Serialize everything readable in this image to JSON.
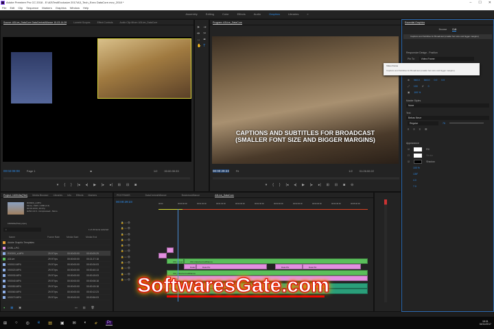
{
  "window": {
    "title": "Adobe Premiere Pro CC 2018 - E:\\A3\\Test\\Exclusive 2017\\A3_Tech_Exec DataCore.mov_2018 *",
    "min": "–",
    "max": "☐",
    "close": "✕"
  },
  "menu": [
    "File",
    "Edit",
    "Clip",
    "Sequence",
    "Markers",
    "Graphics",
    "Window",
    "Help"
  ],
  "workspaces": [
    "Assembly",
    "Editing",
    "Color",
    "Effects",
    "Audio",
    "Graphics",
    "Libraries",
    "»"
  ],
  "source": {
    "tabs": [
      "Source: A3Live_DataCore DataCentralAlliance 10-03-14.09",
      "Lumetri Scopes",
      "Effect Controls",
      "Audio Clip Mixer: A3Live_DataCore"
    ],
    "timecode": "00:02:08:08",
    "page": "Page 1",
    "zoom": "1/2",
    "duration": "00:00:39:33"
  },
  "program": {
    "tab": "Program: A3Live_DataCore",
    "caption_line1": "CAPTIONS AND SUBTITLES FOR BROADCAST",
    "caption_line2": "(SMALLER FONT SIZE AND BIGGER MARGINS)",
    "timecode": "00:00:29:23",
    "fit": "Fit",
    "zoom": "1/2",
    "duration": "01:26:00:22"
  },
  "essential_graphics": {
    "tab": "Essential Graphics",
    "browse": "Browse",
    "edit": "Edit",
    "layer": "Captions and Subtitles for Broadcast (smaller font size and bigger margins)",
    "responsive": "Responsive Design - Position",
    "pin_label": "Pin To:",
    "pin_value": "Video Frame",
    "popup": [
      "Video Frame",
      "Captions and Subtitles for Broadcast (smaller font size and bigger margins)"
    ],
    "pos_x": "960.0",
    "pos_y": "540.0",
    "anchor_x": "0.0",
    "anchor_y": "0.0",
    "scale": "100",
    "rotation": "0",
    "opacity": "100 %",
    "master_styles": "Master Styles",
    "master_value": "None",
    "text_label": "Text",
    "font": "Bebas Neue",
    "font_style": "Regular",
    "font_size": "76",
    "appearance": "Appearance",
    "fill": "Fill",
    "stroke": "Stroke",
    "shadow": "Shadow",
    "shadow_opacity": "100 %",
    "shadow_angle": "135°",
    "shadow_distance": "4.0",
    "shadow_size": "7.0"
  },
  "project": {
    "tabs": [
      "Project: 160918a(Titel)",
      "Media Browser",
      "Libraries",
      "Info",
      "Effects",
      "Markers"
    ],
    "info": [
      "R00300_s.MP4",
      "Movie, 1920 x 1080 (1.0)",
      "00:00:10:00, 29.97p",
      "H264 4:2:0 - Compressed - Mono"
    ],
    "file": "160918a(Titel).prproj",
    "selected": "1 of 23 items selected",
    "columns": [
      "Name",
      "Frame Rate",
      "Media Start",
      "Media End"
    ],
    "rows": [
      {
        "name": "Adobe Graphic Templates",
        "fps": "",
        "start": "",
        "end": "",
        "color": "#e8a23a"
      },
      {
        "name": "DSRL.LPG",
        "fps": "",
        "start": "",
        "end": "",
        "color": "#d88ee0"
      },
      {
        "name": "R00300_s.MP4",
        "fps": "29.97 fps",
        "start": "00:00:00:00",
        "end": "00:00:09:29",
        "color": "#8fb0e8"
      },
      {
        "name": "A3Live",
        "fps": "29.97 fps",
        "start": "00:00:00:00",
        "end": "00:21:27:18",
        "color": "#5bbf5b"
      },
      {
        "name": "V00010.MP4",
        "fps": "29.97 fps",
        "start": "00:00:00:00",
        "end": "00:00:26:03",
        "color": "#8fb0e8"
      },
      {
        "name": "V00020.MP4",
        "fps": "29.97 fps",
        "start": "00:00:00:00",
        "end": "00:00:40:13",
        "color": "#8fb0e8"
      },
      {
        "name": "V00030.MP4",
        "fps": "29.97 fps",
        "start": "00:00:00:00",
        "end": "00:00:15:03",
        "color": "#8fb0e8"
      },
      {
        "name": "V00040.MP4",
        "fps": "29.97 fps",
        "start": "00:00:00:00",
        "end": "00:00:08:18",
        "color": "#8fb0e8"
      },
      {
        "name": "V00050.MP4",
        "fps": "29.97 fps",
        "start": "00:00:00:00",
        "end": "00:00:15:18",
        "color": "#8fb0e8"
      },
      {
        "name": "V00060.MP4",
        "fps": "29.97 fps",
        "start": "00:00:00:00",
        "end": "00:00:12:23",
        "color": "#8fb0e8"
      },
      {
        "name": "V00070.MP4",
        "fps": "29.97 fps",
        "start": "00:00:00:00",
        "end": "00:00:56:03",
        "color": "#8fb0e8"
      }
    ]
  },
  "timeline": {
    "tabs": [
      "PDGTEAMS",
      "DataCentralAlliance",
      "BusinessAlliance",
      "A3Live_DataCore"
    ],
    "timecode": "00:00:29:23",
    "ruler": [
      "00:00",
      "00:00:30:00",
      "00:01:00:00",
      "00:01:30:00",
      "00:02:00:00",
      "00:02:30:00",
      "00:03:00:00",
      "00:03:30:00",
      "00:04:00:00",
      "00:04:30:00",
      "00:05:00:00"
    ],
    "clips": {
      "c1": "OM_Cover",
      "c2": "OM_DataCentralAlliance",
      "c3": "Dataco",
      "c4": "Data PH",
      "c5": "Data PH",
      "c6": "Data PH",
      "c7": "OM_DataCentralAlliance",
      "c8": "White",
      "c9": "Data PH"
    }
  },
  "taskbar": {
    "time": "18:31",
    "date": "04/11/2017"
  },
  "watermark": "SoftwaresGate.com"
}
